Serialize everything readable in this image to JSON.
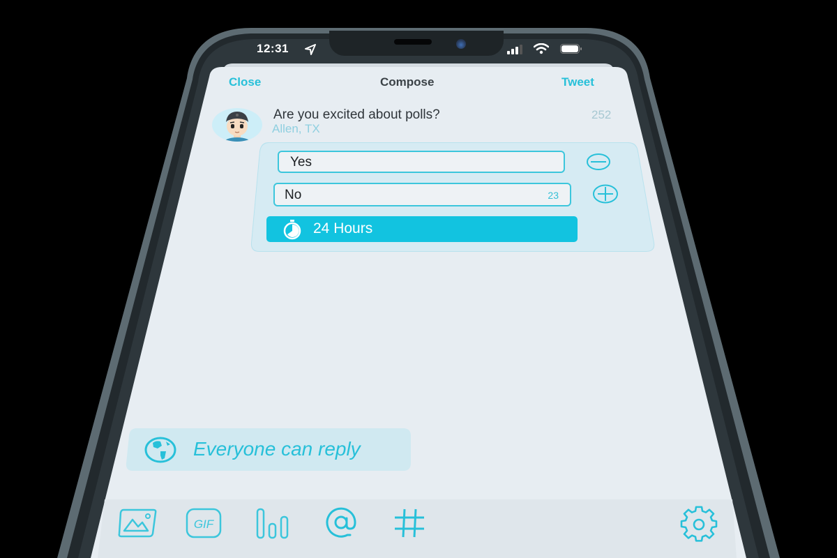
{
  "status_bar": {
    "time": "12:31",
    "location_icon": "location-arrow-icon",
    "signal_icon": "cellular-signal-icon",
    "wifi_icon": "wifi-icon",
    "battery_icon": "battery-icon"
  },
  "nav": {
    "close_label": "Close",
    "title": "Compose",
    "tweet_label": "Tweet"
  },
  "compose": {
    "text": "Are you excited about polls?",
    "location": "Allen, TX",
    "characters_remaining": "252"
  },
  "poll": {
    "options": [
      {
        "value": "Yes",
        "remaining": ""
      },
      {
        "value": "No",
        "remaining": "23"
      }
    ],
    "remove_option_icon": "minus-circle-icon",
    "add_option_icon": "plus-circle-icon",
    "duration_label": "24 Hours",
    "duration_icon": "stopwatch-icon"
  },
  "reply_setting": {
    "label": "Everyone can reply",
    "icon": "globe-icon"
  },
  "toolbar": {
    "items": [
      {
        "name": "image",
        "icon": "image-icon"
      },
      {
        "name": "gif",
        "icon": "gif-icon",
        "label": "GIF"
      },
      {
        "name": "poll",
        "icon": "poll-icon"
      },
      {
        "name": "mention",
        "icon": "at-icon"
      },
      {
        "name": "hashtag",
        "icon": "hashtag-icon"
      },
      {
        "name": "settings",
        "icon": "gear-icon"
      }
    ]
  },
  "colors": {
    "accent": "#27c0d9",
    "accent_fill": "#12c3e0",
    "screen_bg": "#e7edf2",
    "frame": "#22292d"
  }
}
